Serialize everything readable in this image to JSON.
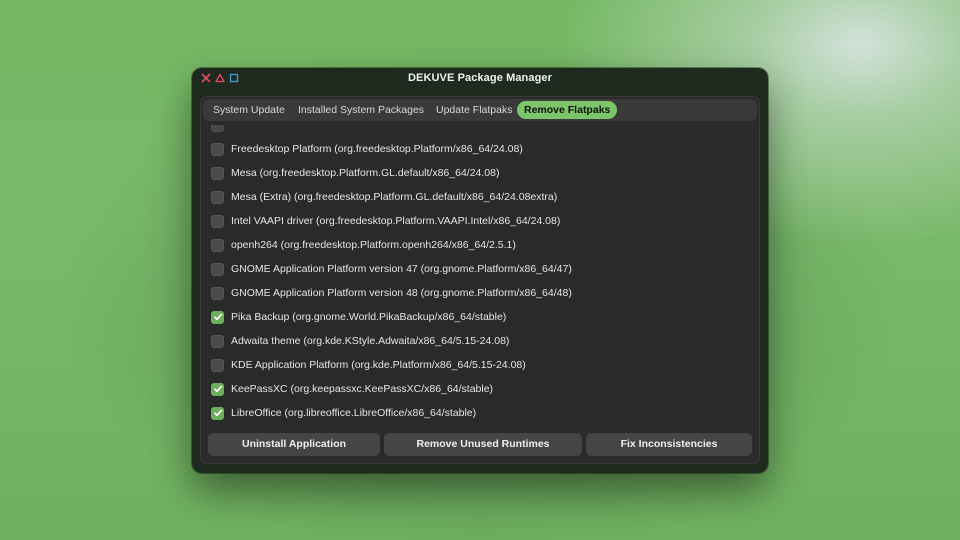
{
  "window": {
    "title": "DEKUVE Package Manager",
    "controls": [
      {
        "icon": "close-x-icon",
        "color": "#e84a5f"
      },
      {
        "icon": "triangle-icon",
        "color": "#e84a5f"
      },
      {
        "icon": "square-icon",
        "color": "#3aa0e0"
      }
    ]
  },
  "tabs": [
    {
      "label": "System Update",
      "active": false
    },
    {
      "label": "Installed System Packages",
      "active": false
    },
    {
      "label": "Update Flatpaks",
      "active": false
    },
    {
      "label": "Remove Flatpaks",
      "active": true
    }
  ],
  "flatpaks": [
    {
      "label": "Freedesktop Platform (org.freedesktop.Platform/x86_64/24.08)",
      "checked": false
    },
    {
      "label": "Mesa (org.freedesktop.Platform.GL.default/x86_64/24.08)",
      "checked": false
    },
    {
      "label": "Mesa (Extra) (org.freedesktop.Platform.GL.default/x86_64/24.08extra)",
      "checked": false
    },
    {
      "label": "Intel VAAPI driver (org.freedesktop.Platform.VAAPI.Intel/x86_64/24.08)",
      "checked": false
    },
    {
      "label": "openh264 (org.freedesktop.Platform.openh264/x86_64/2.5.1)",
      "checked": false
    },
    {
      "label": "GNOME Application Platform version 47 (org.gnome.Platform/x86_64/47)",
      "checked": false
    },
    {
      "label": "GNOME Application Platform version 48 (org.gnome.Platform/x86_64/48)",
      "checked": false
    },
    {
      "label": "Pika Backup (org.gnome.World.PikaBackup/x86_64/stable)",
      "checked": true
    },
    {
      "label": "Adwaita theme (org.kde.KStyle.Adwaita/x86_64/5.15-24.08)",
      "checked": false
    },
    {
      "label": "KDE Application Platform (org.kde.Platform/x86_64/5.15-24.08)",
      "checked": false
    },
    {
      "label": "KeePassXC (org.keepassxc.KeePassXC/x86_64/stable)",
      "checked": true
    },
    {
      "label": "LibreOffice (org.libreoffice.LibreOffice/x86_64/stable)",
      "checked": true
    }
  ],
  "actions": {
    "uninstall": "Uninstall Application",
    "remove_unused": "Remove Unused Runtimes",
    "fix": "Fix Inconsistencies"
  },
  "colors": {
    "accent": "#7cc56a",
    "checkbox_checked": "#6cb05c"
  }
}
